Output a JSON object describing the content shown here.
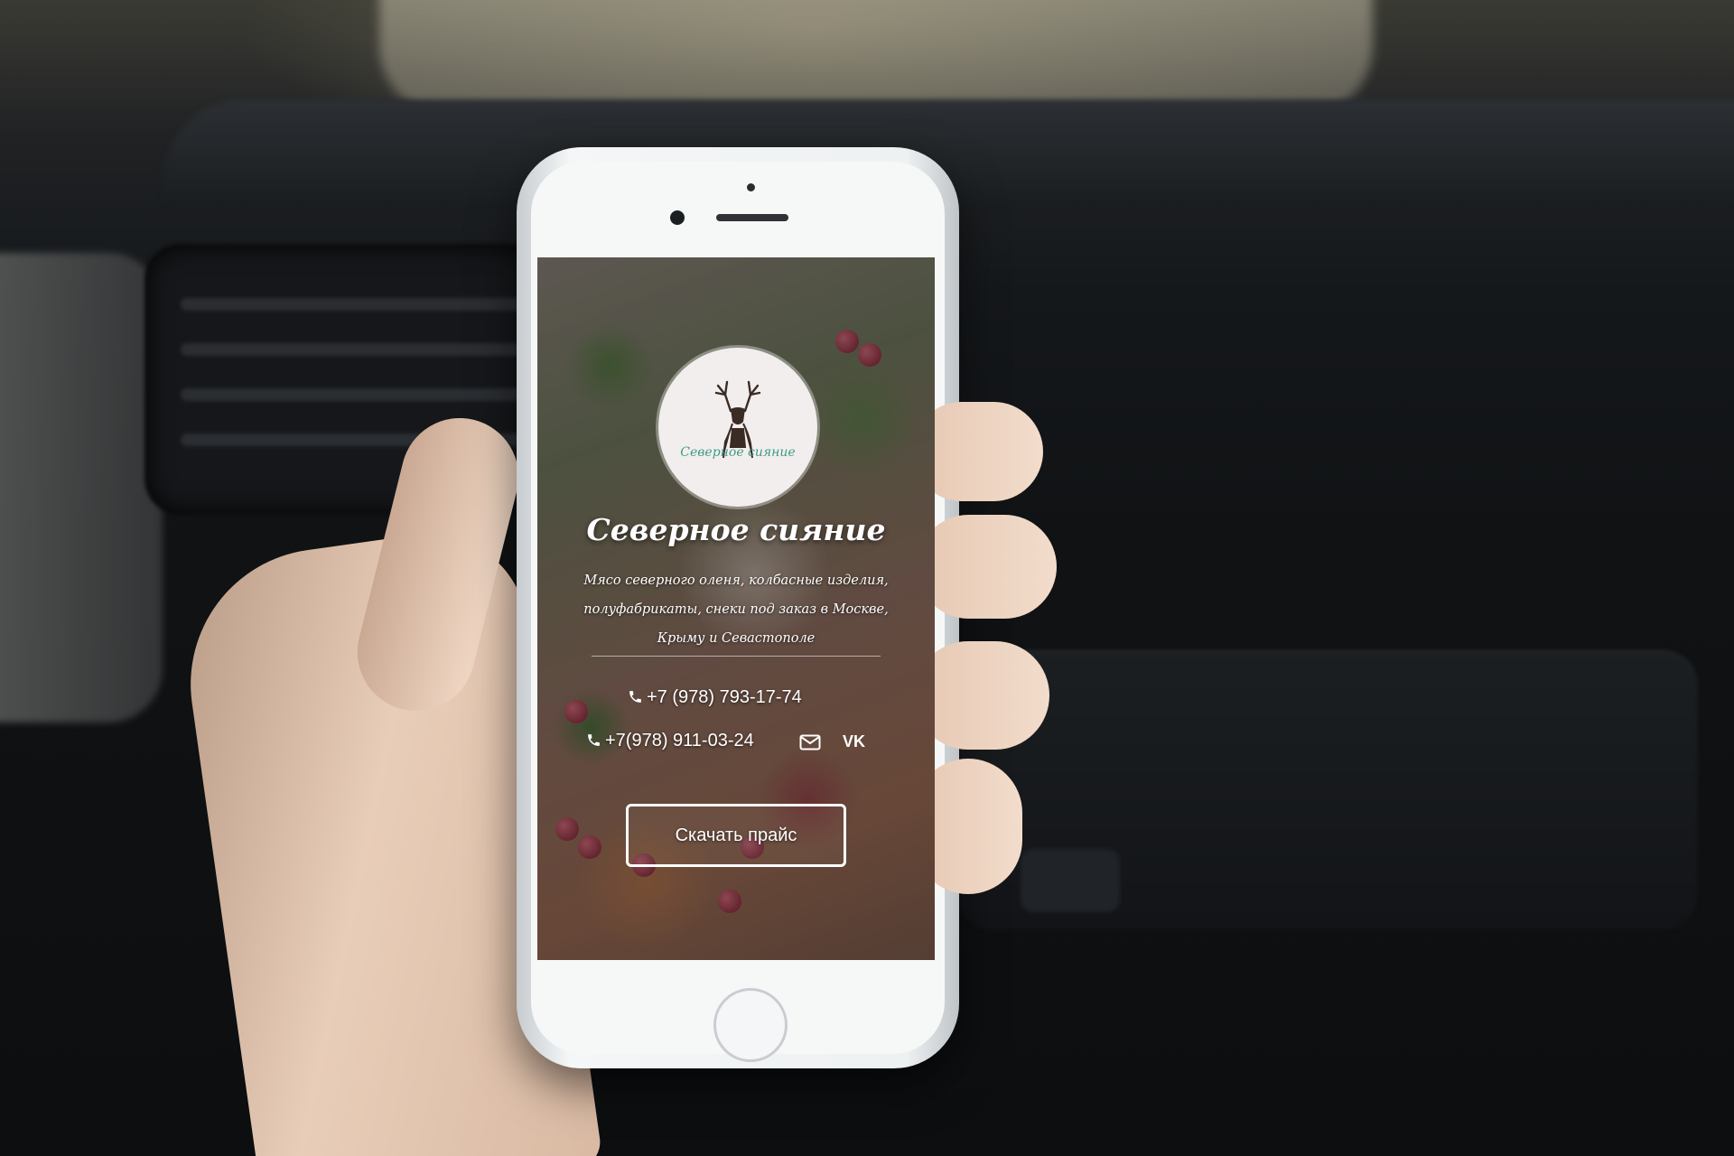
{
  "site": {
    "logo_text": "Северное сияние",
    "title": "Северное сияние",
    "subtitle": "Мясо северного оленя, колбасные изделия, полуфабрикаты, снеки под заказ в Москве, Крыму и Севастополе",
    "phone_primary": "+7 (978) 793-17-74",
    "phone_secondary": "+7(978) 911-03-24",
    "vk_label": "VK",
    "price_button_label": "Скачать прайс"
  },
  "icons": {
    "phone": "phone-icon",
    "mail": "mail-icon",
    "vk": "vk-icon",
    "logo": "deer-logo-icon"
  },
  "colors": {
    "logo_text": "#3d9c86",
    "button_border": "#ffffff"
  }
}
